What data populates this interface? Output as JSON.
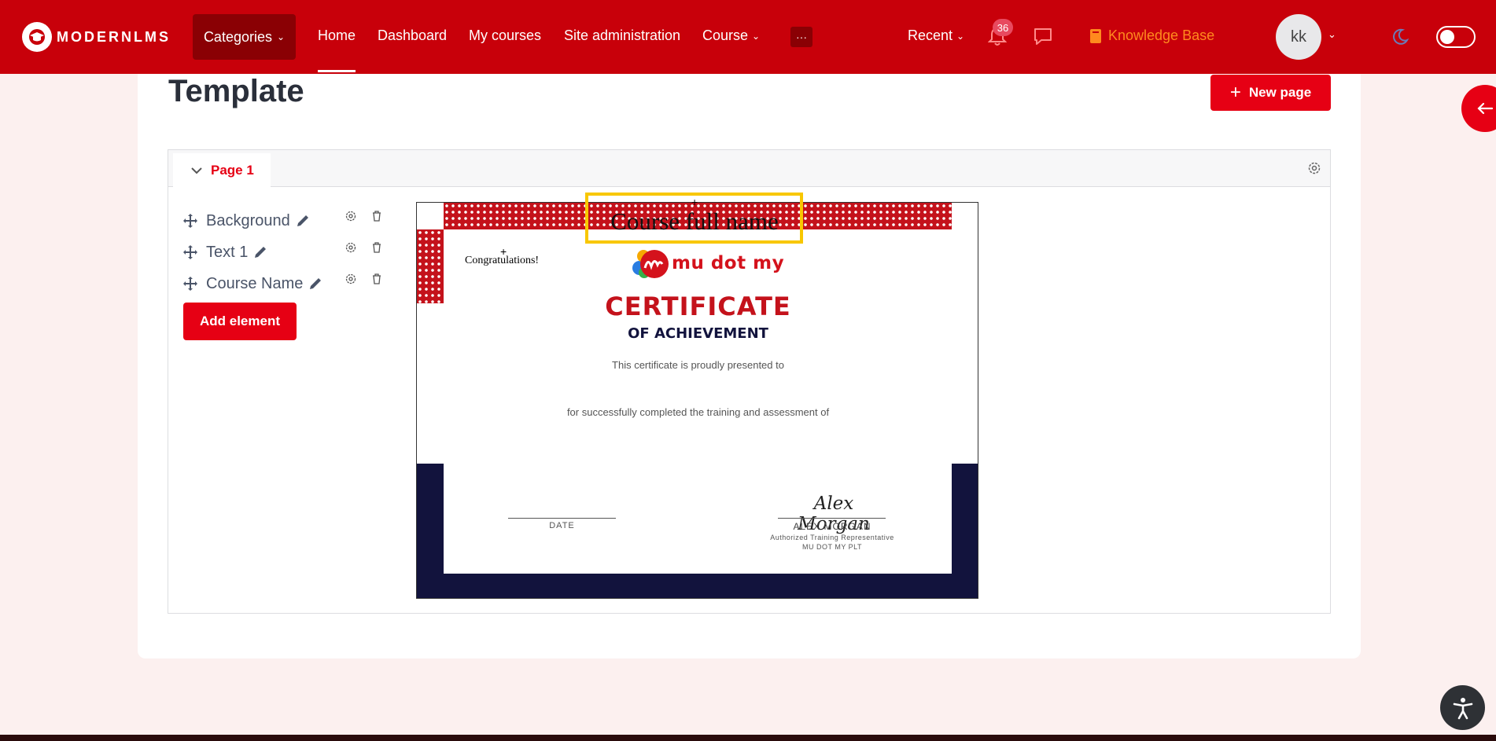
{
  "nav": {
    "brand": "MODERNLMS",
    "categories": "Categories",
    "home": "Home",
    "dashboard": "Dashboard",
    "my_courses": "My courses",
    "site_admin": "Site administration",
    "course": "Course",
    "more": "···",
    "recent": "Recent",
    "notification_count": "36",
    "knowledge_base": "Knowledge Base",
    "avatar_initials": "kk"
  },
  "page": {
    "title": "Template",
    "new_page_label": "New page",
    "page_tab": "Page 1"
  },
  "elements": [
    {
      "label": "Background"
    },
    {
      "label": "Text 1"
    },
    {
      "label": "Course Name"
    }
  ],
  "add_element_label": "Add element",
  "certificate": {
    "course_full_name": "Course full name",
    "congratulations": "Congratulations!",
    "brand": "mu dot my",
    "heading": "CERTIFICATE",
    "subheading": "OF ACHIEVEMENT",
    "presented_to": "This certificate is proudly presented to",
    "completed": "for successfully completed the training and assessment of",
    "date_label": "DATE",
    "signature": "Alex Morgan",
    "signer_name": "ALEX MORGAN",
    "signer_title": "Authorized Training Representative",
    "signer_org": "MU DOT MY PLT"
  },
  "colors": {
    "primary": "#c8000a",
    "button": "#e60014",
    "navy": "#12133d",
    "selection": "#f8c700"
  }
}
